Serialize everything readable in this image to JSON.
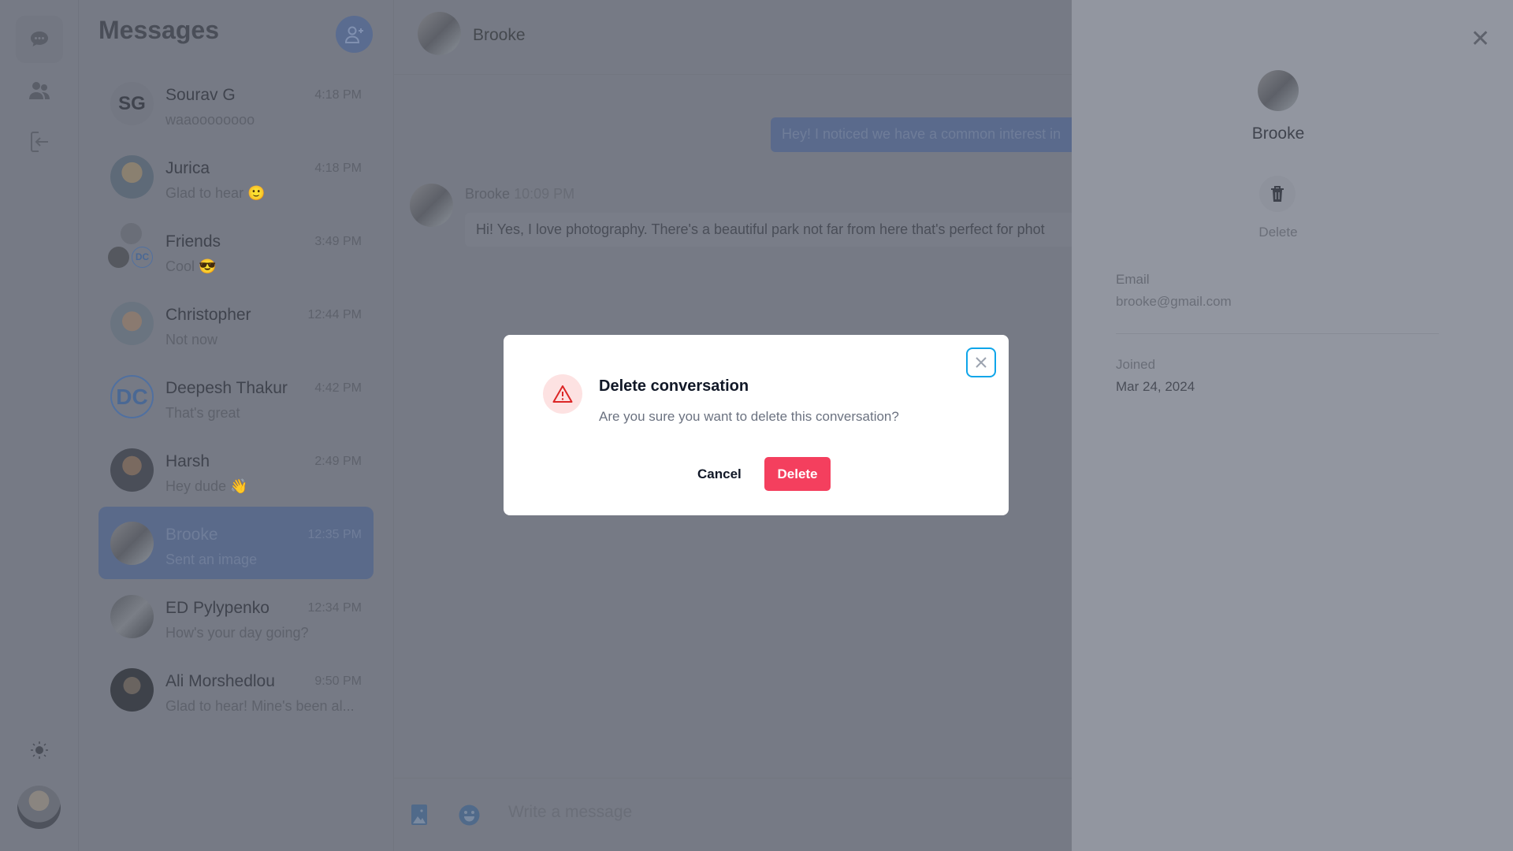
{
  "rail": {
    "icons": [
      "chat-icon",
      "users-icon",
      "logout-icon"
    ],
    "theme_icon": "sun-icon"
  },
  "list": {
    "title": "Messages",
    "items": [
      {
        "name": "Sourav G",
        "time": "4:18 PM",
        "preview": "waaoooooooo",
        "avatar": "SG"
      },
      {
        "name": "Jurica",
        "time": "4:18 PM",
        "preview": "Glad to hear 🙂"
      },
      {
        "name": "Friends",
        "time": "3:49 PM",
        "preview": "Cool 😎"
      },
      {
        "name": "Christopher",
        "time": "12:44 PM",
        "preview": "Not now"
      },
      {
        "name": "Deepesh Thakur",
        "time": "4:42 PM",
        "preview": "That's great",
        "avatar": "DC"
      },
      {
        "name": "Harsh",
        "time": "2:49 PM",
        "preview": "Hey dude 👋"
      },
      {
        "name": "Brooke",
        "time": "12:35 PM",
        "preview": "Sent an image"
      },
      {
        "name": "ED Pylypenko",
        "time": "12:34 PM",
        "preview": "How's your day going?"
      },
      {
        "name": "Ali Morshedlou",
        "time": "9:50 PM",
        "preview": "Glad to hear! Mine's been al..."
      }
    ]
  },
  "chat": {
    "contact": "Brooke",
    "messages": [
      {
        "type": "sent",
        "text": "Hey! I noticed we have a common interest in"
      },
      {
        "type": "received",
        "sender": "Brooke",
        "time": "10:09 PM",
        "text": "Hi! Yes, I love photography. There's a beautiful park not far from here that's perfect for phot"
      }
    ],
    "input_placeholder": "Write a message"
  },
  "profile": {
    "name": "Brooke",
    "delete_label": "Delete",
    "email_label": "Email",
    "email": "brooke@gmail.com",
    "joined_label": "Joined",
    "joined": "Mar 24, 2024"
  },
  "dialog": {
    "title": "Delete conversation",
    "message": "Are you sure you want to delete this conversation?",
    "cancel": "Cancel",
    "confirm": "Delete",
    "colors": {
      "danger": "#f43f5e",
      "focus": "#0ea5e9"
    }
  }
}
